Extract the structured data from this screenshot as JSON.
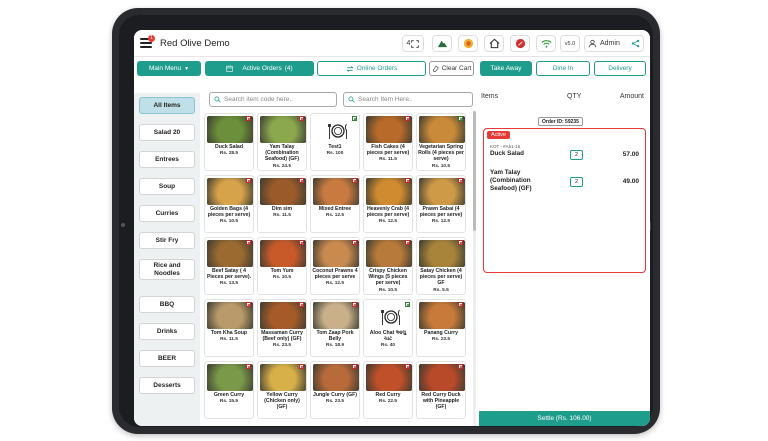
{
  "app": {
    "title": "Red Olive Demo",
    "notification_count": "1"
  },
  "header": {
    "icons": [
      {
        "icon": "qr-scan-icon",
        "label": "4"
      },
      {
        "icon": "mountain-icon",
        "label": ""
      },
      {
        "icon": "food-icon",
        "label": ""
      },
      {
        "icon": "home-icon",
        "label": ""
      },
      {
        "icon": "offer-icon",
        "label": ""
      },
      {
        "icon": "wifi-icon",
        "label": ""
      },
      {
        "icon": "version-icon",
        "label": "v5.0"
      }
    ],
    "user": "Admin"
  },
  "toolbar": {
    "main_menu": "Main Menu",
    "active_orders": "Active Orders",
    "active_orders_count": "(4)",
    "online_orders": "Online Orders",
    "clear_cart": "Clear Cart",
    "order_types": [
      "Take Away",
      "Dine In",
      "Delivery"
    ]
  },
  "search": {
    "code_placeholder": "Search item code here..",
    "item_placeholder": "Search Item Here.."
  },
  "categories": [
    "All Items",
    "Salad 20",
    "Entrees",
    "Soup",
    "Curries",
    "Stir Fry",
    "Rice and Noodles",
    "BBQ",
    "Drinks",
    "BEER",
    "Desserts"
  ],
  "items": [
    {
      "name": "Duck Salad",
      "price": "Rs. 28.5",
      "veg": false,
      "color": "#6b8f3a"
    },
    {
      "name": "Yam Talay (Combination Seafood) (GF)",
      "price": "Rs. 24.5",
      "veg": false,
      "color": "#8ba84e"
    },
    {
      "name": "Test1",
      "price": "Rs. 100",
      "veg": true,
      "color": "placeholder"
    },
    {
      "name": "Fish Cakes (4 pieces per serve)",
      "price": "Rs. 11.5",
      "veg": false,
      "color": "#b76a2a"
    },
    {
      "name": "Vegetarian Spring Rolls (4 pieces per serve)",
      "price": "Rs. 10.5",
      "veg": true,
      "color": "#c98a3a"
    },
    {
      "name": "Golden Bags (4 pieces per serve)",
      "price": "Rs. 10.5",
      "veg": false,
      "color": "#d6a24a"
    },
    {
      "name": "Dim sim",
      "price": "Rs. 11.5",
      "veg": false,
      "color": "#9a5a2a"
    },
    {
      "name": "Mixed Entree",
      "price": "Rs. 12.5",
      "veg": false,
      "color": "#c87a40"
    },
    {
      "name": "Heavenly Crab (4 pieces per serve)",
      "price": "Rs. 12.5",
      "veg": false,
      "color": "#d08a30"
    },
    {
      "name": "Prawn Sabai (4 pieces per serve)",
      "price": "Rs. 12.5",
      "veg": false,
      "color": "#cf9a48"
    },
    {
      "name": "Beef Satay ( 4 Pieces per serve).",
      "price": "Rs. 13.5",
      "veg": false,
      "color": "#9a6a30"
    },
    {
      "name": "Tom Yum",
      "price": "Rs. 10.5",
      "veg": false,
      "color": "#c85a2a"
    },
    {
      "name": "Coconut Prawns 4 pieces per serve",
      "price": "Rs. 12.5",
      "veg": false,
      "color": "#c98a50"
    },
    {
      "name": "Crispy Chicken Wings (5 pieces per serve)",
      "price": "Rs. 10.5",
      "veg": false,
      "color": "#b87a3a"
    },
    {
      "name": "Satay Chicken (4 pieces per serve) GF",
      "price": "Rs. 5.5",
      "veg": false,
      "color": "#a8843a"
    },
    {
      "name": "Tom Kha Soup",
      "price": "Rs. 11.5",
      "veg": false,
      "color": "#b99a6a"
    },
    {
      "name": "Massaman Curry (Beef only) (GF)",
      "price": "Rs. 23.5",
      "veg": false,
      "color": "#a65a2a"
    },
    {
      "name": "Tom Zaap Pork Belly",
      "price": "Rs. 18.9",
      "veg": false,
      "color": "#c9b08a"
    },
    {
      "name": "Aloo Chat આલુ ચાટ",
      "price": "Rs. 40",
      "veg": true,
      "color": "placeholder"
    },
    {
      "name": "Panang Curry",
      "price": "Rs. 23.5",
      "veg": false,
      "color": "#c87a3a"
    },
    {
      "name": "Green Curry",
      "price": "Rs. 15.5",
      "veg": false,
      "color": "#7a9a4a"
    },
    {
      "name": "Yellow Curry (Chicken only) (GF)",
      "price": "",
      "veg": false,
      "color": "#d8b04a"
    },
    {
      "name": "Jungle Curry (GF)",
      "price": "Rs. 23.5",
      "veg": false,
      "color": "#b86a3a"
    },
    {
      "name": "Red Curry",
      "price": "Rs. 22.5",
      "veg": false,
      "color": "#c0502a"
    },
    {
      "name": "Red Curry Duck with Pineapple (GF)",
      "price": "",
      "veg": false,
      "color": "#b84a2a"
    }
  ],
  "order": {
    "headers": {
      "items": "Items",
      "qty": "QTY",
      "amount": "Amount"
    },
    "order_id": "Order ID: 59235",
    "status": "Active",
    "kot": "KOT - #Ab1-15",
    "lines": [
      {
        "name": "Duck Salad",
        "qty": "2",
        "amount": "57.00"
      },
      {
        "name": "Yam Talay (Combination Seafood) (GF)",
        "qty": "2",
        "amount": "49.00"
      }
    ],
    "settle": "Settle (Rs. 106.00)"
  }
}
